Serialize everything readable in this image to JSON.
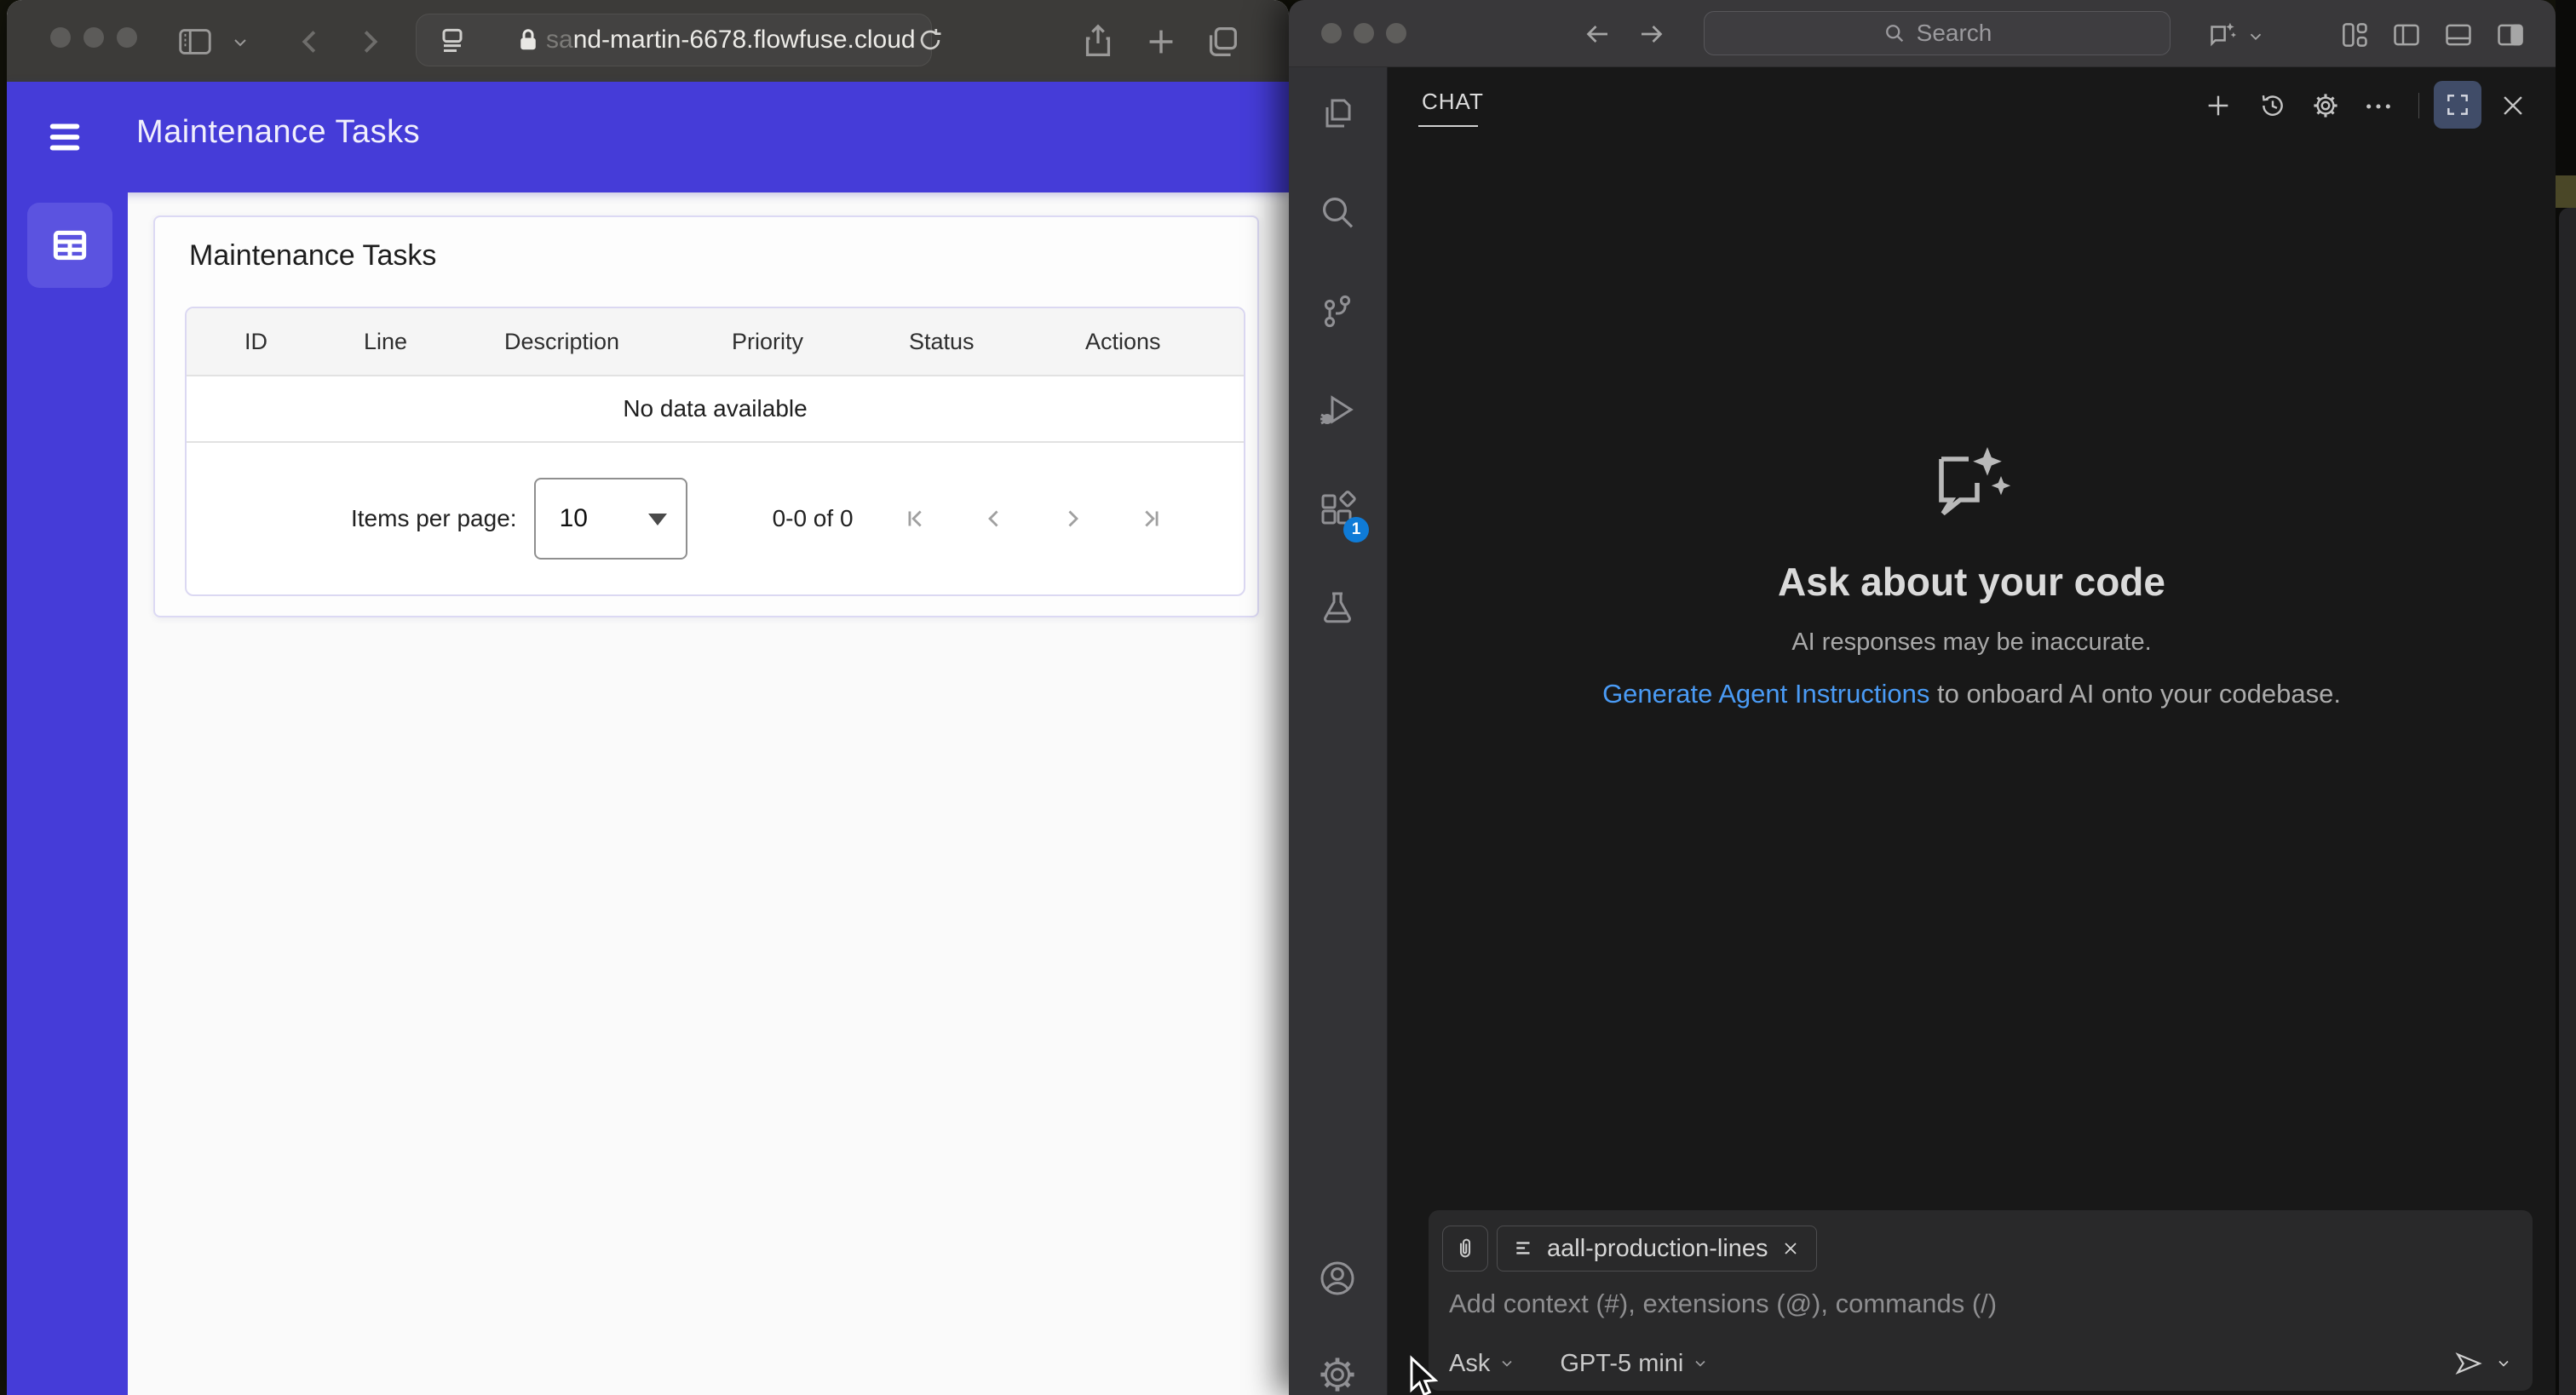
{
  "browser": {
    "url_faded": "sa",
    "url_main": "nd-martin-6678.flowfuse.cloud",
    "app_header": {
      "title": "Maintenance Tasks"
    },
    "page": {
      "card_title": "Maintenance Tasks",
      "table": {
        "columns": [
          "ID",
          "Line",
          "Description",
          "Priority",
          "Status",
          "Actions"
        ],
        "empty_text": "No data available"
      },
      "pagination": {
        "items_per_page_label": "Items per page:",
        "items_per_page_value": "10",
        "range_text": "0-0 of 0"
      }
    }
  },
  "vscode": {
    "titlebar": {
      "search_placeholder": "Search"
    },
    "activity_bar": {
      "extensions_badge": "1"
    },
    "chat": {
      "tab_label": "CHAT",
      "empty_state": {
        "title": "Ask about your code",
        "subtitle": "AI responses may be inaccurate.",
        "link_text": "Generate Agent Instructions",
        "link_suffix": " to onboard AI onto your codebase."
      },
      "input": {
        "context_chip": "aall-production-lines",
        "placeholder": "Add context (#), extensions (@), commands (/)",
        "mode": "Ask",
        "model": "GPT-5 mini"
      }
    }
  },
  "colors": {
    "accent_purple": "#453cd8",
    "accent_purple_light": "#5b53e0",
    "badge_blue": "#0f7bd7",
    "link_blue": "#4a9bf5"
  }
}
